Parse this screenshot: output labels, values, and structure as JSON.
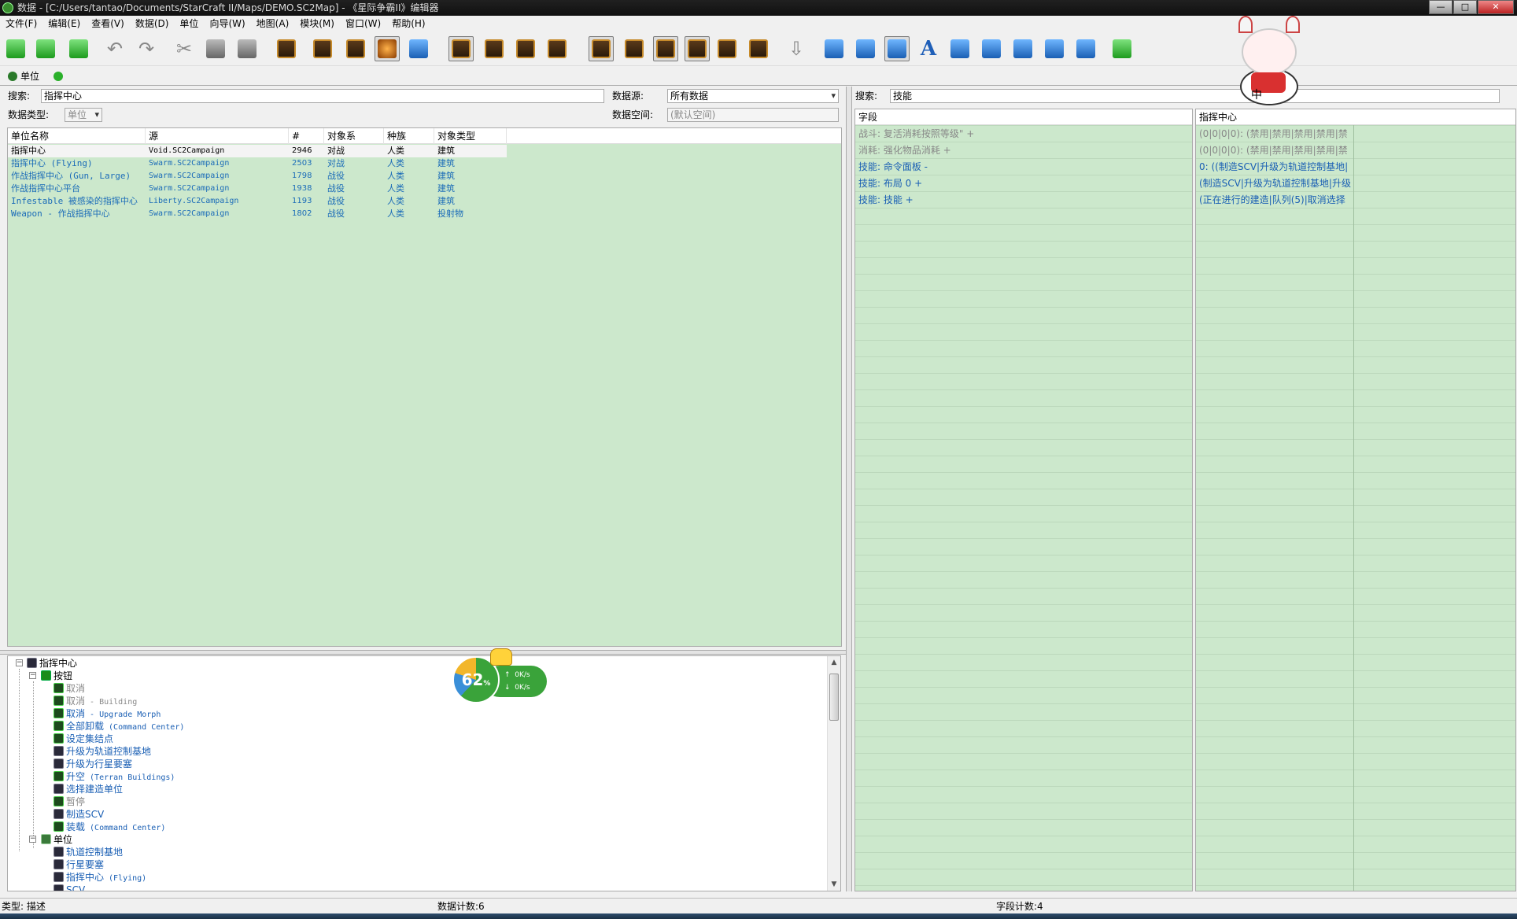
{
  "title": "数据 - [C:/Users/tantao/Documents/StarCraft II/Maps/DEMO.SC2Map] - 《星际争霸II》编辑器",
  "menu": [
    "文件(F)",
    "编辑(E)",
    "查看(V)",
    "数据(D)",
    "单位",
    "向导(W)",
    "地图(A)",
    "模块(M)",
    "窗口(W)",
    "帮助(H)"
  ],
  "tabs": {
    "unit": "单位"
  },
  "left": {
    "search_label": "搜索:",
    "search_value": "指挥中心",
    "type_label": "数据类型:",
    "type_value": "单位",
    "source_label": "数据源:",
    "source_value": "所有数据",
    "space_label": "数据空间:",
    "space_placeholder": "(默认空间)",
    "columns": [
      "单位名称",
      "源",
      "#",
      "对象系",
      "种族",
      "对象类型"
    ],
    "rows": [
      {
        "name": "指挥中心",
        "source": "Void.SC2Campaign",
        "num": "2946",
        "family": "对战",
        "race": "人类",
        "type": "建筑"
      },
      {
        "name": "指挥中心 (Flying)",
        "source": "Swarm.SC2Campaign",
        "num": "2503",
        "family": "对战",
        "race": "人类",
        "type": "建筑"
      },
      {
        "name": "作战指挥中心 (Gun, Large)",
        "source": "Swarm.SC2Campaign",
        "num": "1798",
        "family": "战役",
        "race": "人类",
        "type": "建筑"
      },
      {
        "name": "作战指挥中心平台",
        "source": "Swarm.SC2Campaign",
        "num": "1938",
        "family": "战役",
        "race": "人类",
        "type": "建筑"
      },
      {
        "name": "Infestable 被感染的指挥中心",
        "source": "Liberty.SC2Campaign",
        "num": "1193",
        "family": "战役",
        "race": "人类",
        "type": "建筑"
      },
      {
        "name": "Weapon - 作战指挥中心",
        "source": "Swarm.SC2Campaign",
        "num": "1802",
        "family": "战役",
        "race": "人类",
        "type": "投射物"
      }
    ]
  },
  "tree": {
    "root": "指挥中心",
    "buttons_folder": "按钮",
    "buttons": [
      {
        "label": "取消",
        "suffix": "",
        "gray": true
      },
      {
        "label": "取消",
        "suffix": " - Building",
        "gray": true
      },
      {
        "label": "取消",
        "suffix": " - Upgrade Morph",
        "gray": false
      },
      {
        "label": "全部卸载",
        "suffix": " (Command Center)",
        "gray": false
      },
      {
        "label": "设定集结点",
        "suffix": "",
        "gray": false
      },
      {
        "label": "升级为轨道控制基地",
        "suffix": "",
        "gray": false
      },
      {
        "label": "升级为行星要塞",
        "suffix": "",
        "gray": false
      },
      {
        "label": "升空",
        "suffix": " (Terran Buildings)",
        "gray": false
      },
      {
        "label": "选择建造单位",
        "suffix": "",
        "gray": false
      },
      {
        "label": "暂停",
        "suffix": "",
        "gray": true
      },
      {
        "label": "制造SCV",
        "suffix": "",
        "gray": false
      },
      {
        "label": "装载",
        "suffix": " (Command Center)",
        "gray": false
      }
    ],
    "units_folder": "单位",
    "units": [
      {
        "label": "轨道控制基地",
        "suffix": ""
      },
      {
        "label": "行星要塞",
        "suffix": ""
      },
      {
        "label": "指挥中心",
        "suffix": " (Flying)"
      },
      {
        "label": "SCV",
        "suffix": ""
      }
    ]
  },
  "right": {
    "search_label": "搜索:",
    "search_value": "技能",
    "field_header": "字段",
    "value_header": "指挥中心",
    "fields": [
      {
        "label": "战斗: 复活消耗按照等级\" +",
        "gray": true
      },
      {
        "label": "消耗: 强化物品消耗 +",
        "gray": true
      },
      {
        "label": "技能: 命令面板 -",
        "gray": false
      },
      {
        "label": "技能:     布局 0 +",
        "gray": false
      },
      {
        "label": "技能: 技能 +",
        "gray": false
      }
    ],
    "values": [
      {
        "label": "(0|0|0|0): (禁用|禁用|禁用|禁用|禁",
        "gray": true
      },
      {
        "label": "(0|0|0|0): (禁用|禁用|禁用|禁用|禁",
        "gray": true
      },
      {
        "label": "0: ((制造SCV|升级为轨道控制基地|",
        "gray": false
      },
      {
        "label": "(制造SCV|升级为轨道控制基地|升级",
        "gray": false
      },
      {
        "label": "(正在进行的建造|队列(5)|取消选择",
        "gray": false
      }
    ]
  },
  "status": {
    "type_label": "类型: 描述",
    "data_count": "数据计数:6",
    "field_count": "字段计数:4"
  },
  "widget": {
    "percent": "62",
    "percent_sign": "%",
    "up": "0K/s",
    "down": "0K/s"
  },
  "mascot": {
    "text": "中"
  },
  "window_buttons": {
    "min": "—",
    "max": "□",
    "close": "✕"
  }
}
